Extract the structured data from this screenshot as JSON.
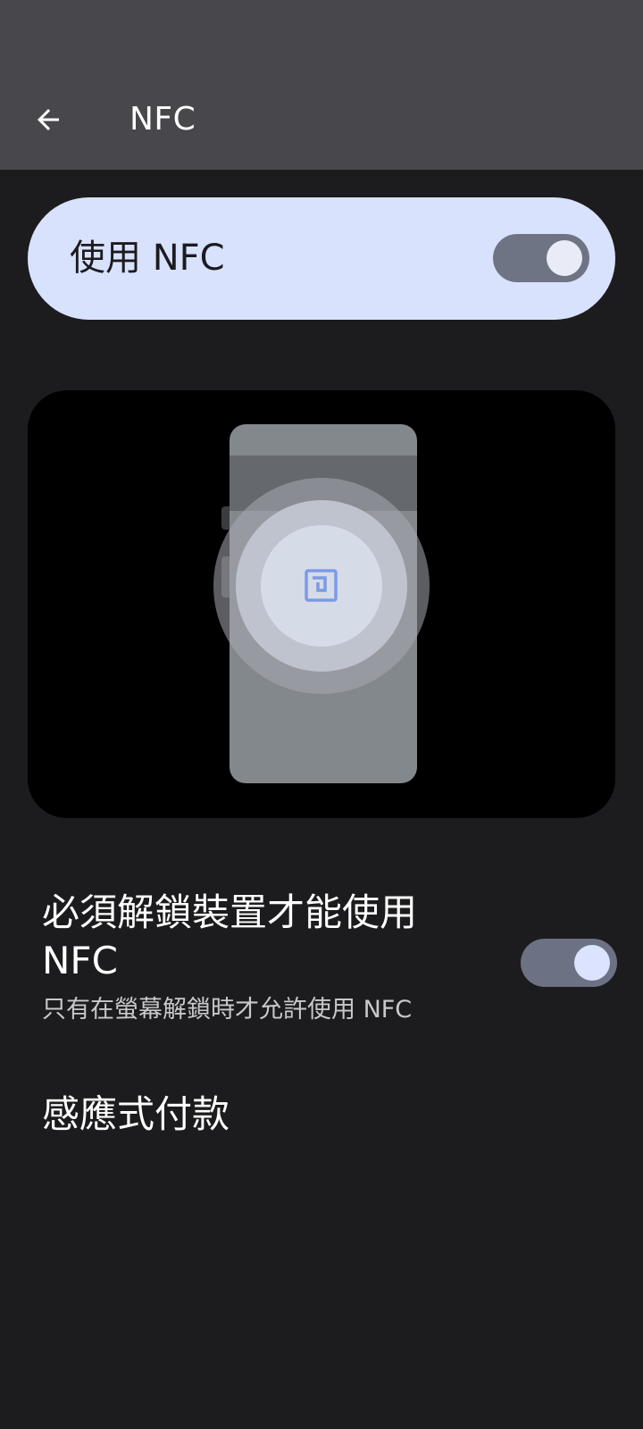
{
  "app_bar": {
    "title": "NFC",
    "back_icon": "arrow-back-icon"
  },
  "main_toggle": {
    "label": "使用 NFC",
    "checked": true
  },
  "illustration": {
    "icon": "nfc-icon"
  },
  "preferences": {
    "require_unlock": {
      "title": "必須解鎖裝置才能使用 NFC",
      "summary": "只有在螢幕解鎖時才允許使用 NFC",
      "checked": true
    },
    "tap_and_pay": {
      "title": "感應式付款"
    }
  },
  "colors": {
    "app_bar_bg": "#48474c",
    "page_bg": "#1c1c1e",
    "card_bg": "#d9e2fd",
    "switch_track": "#6f7484",
    "nfc_icon_blue": "#7b9be6"
  }
}
